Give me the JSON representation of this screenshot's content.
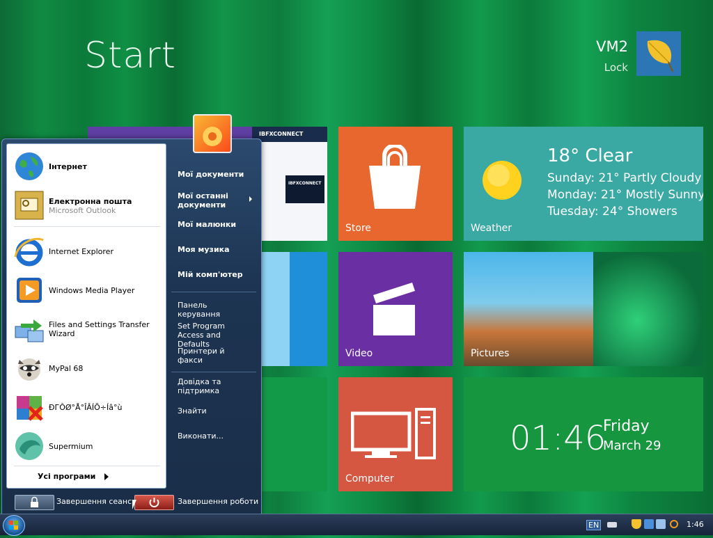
{
  "start_screen": {
    "title": "Start",
    "user_name": "VM2",
    "lock_label": "Lock"
  },
  "tiles": {
    "store_label": "Store",
    "weather_label": "Weather",
    "weather_main": "18° Clear",
    "weather_lines": [
      "Sunday: 21° Partly Cloudy",
      "Monday: 21° Mostly Sunny",
      "Tuesday: 24° Showers"
    ],
    "video_label": "Video",
    "pictures_label": "Pictures",
    "computer_label": "Computer",
    "clock_time": "01:46",
    "clock_day": "Friday",
    "clock_date": "March 29",
    "browser_preview_text": "IBFXCONNECT"
  },
  "start_menu": {
    "left_items": [
      {
        "title": "Інтернет",
        "subtitle": ""
      },
      {
        "title": "Електронна пошта",
        "subtitle": "Microsoft Outlook"
      },
      {
        "title": "Internet Explorer",
        "subtitle": ""
      },
      {
        "title": "Windows Media Player",
        "subtitle": ""
      },
      {
        "title": "Files and Settings Transfer Wizard",
        "subtitle": ""
      },
      {
        "title": "MyPal 68",
        "subtitle": ""
      },
      {
        "title": "ÐГÔØ°Å°ÎÂÍÕ÷Íâ°ù",
        "subtitle": ""
      },
      {
        "title": "Supermium",
        "subtitle": ""
      }
    ],
    "all_programs": "Усі програми",
    "right_items": [
      "Мої документи",
      "Мої останні документи",
      "Мої малюнки",
      "Моя музика",
      "Мій комп'ютер",
      "Панель керування",
      "Set Program Access and Defaults",
      "Принтери й факси",
      "Довідка та підтримка",
      "Знайти",
      "Виконати..."
    ],
    "log_off": "Завершення сеансу",
    "shut_down": "Завершення роботи"
  },
  "taskbar": {
    "language": "EN",
    "time": "1:46"
  },
  "colors": {
    "store": "#e8672f",
    "weather": "#3aa8a3",
    "video": "#6a2fa3",
    "computer": "#d55741",
    "clock": "#16963f",
    "blue_tile": "#1e8fd8"
  }
}
